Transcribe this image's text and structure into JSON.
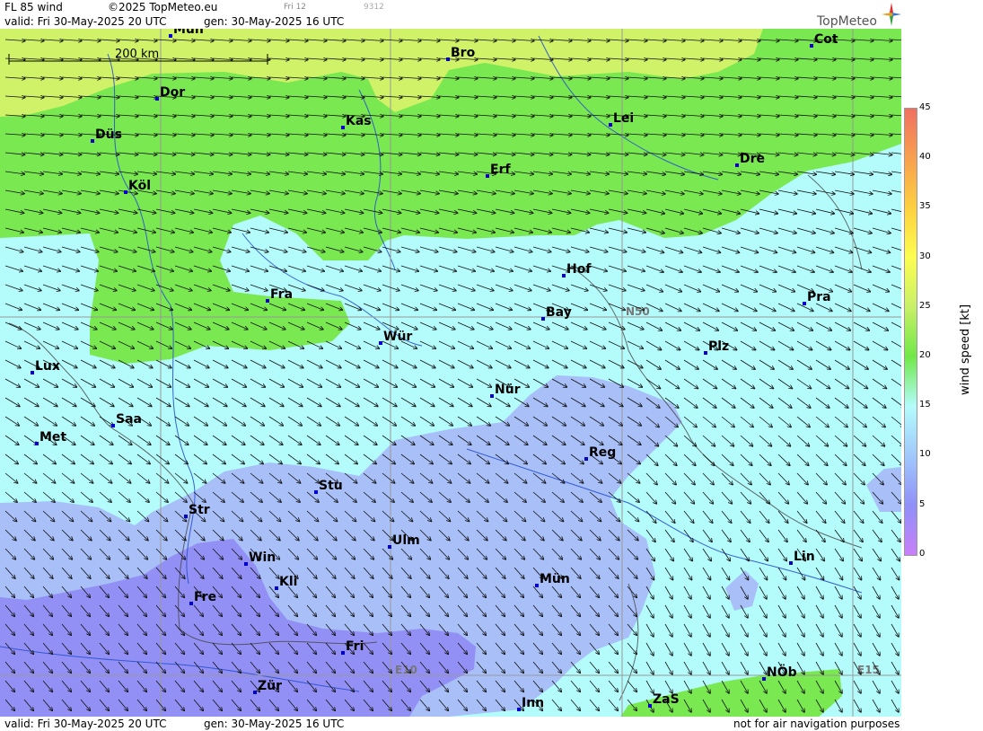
{
  "header": {
    "title": "FL 85 wind",
    "copyright": "©2025 TopMeteo.eu",
    "slot_label": "Fri 12",
    "code": "9312",
    "valid": "valid:  Fri  30-May-2025  20 UTC",
    "gen": "gen:  30-May-2025 16 UTC",
    "logo": "TopMeteo"
  },
  "footer": {
    "valid": "valid:  Fri  30-May-2025  20 UTC",
    "gen": "gen:  30-May-2025 16 UTC",
    "disclaimer": "not for air navigation purposes"
  },
  "scale_bar": {
    "label": "200 km"
  },
  "grid_labels": {
    "n50": "N50",
    "e10": "E10",
    "e15": "E15"
  },
  "cities": [
    {
      "name": "Mün",
      "id": "top"
    },
    {
      "name": "Bro"
    },
    {
      "name": "Cot"
    },
    {
      "name": "Dor"
    },
    {
      "name": "Kas"
    },
    {
      "name": "Lei"
    },
    {
      "name": "Düs"
    },
    {
      "name": "Dre"
    },
    {
      "name": "Erf"
    },
    {
      "name": "Köl"
    },
    {
      "name": "Hof"
    },
    {
      "name": "Fra"
    },
    {
      "name": "Pra"
    },
    {
      "name": "Bay"
    },
    {
      "name": "Wür"
    },
    {
      "name": "Plz"
    },
    {
      "name": "Lux"
    },
    {
      "name": "Nür"
    },
    {
      "name": "Saa"
    },
    {
      "name": "Met"
    },
    {
      "name": "Reg"
    },
    {
      "name": "Stu"
    },
    {
      "name": "Str"
    },
    {
      "name": "Ulm"
    },
    {
      "name": "Win"
    },
    {
      "name": "Lin"
    },
    {
      "name": "Kli"
    },
    {
      "name": "Mün"
    },
    {
      "name": "Fre"
    },
    {
      "name": "Fri"
    },
    {
      "name": "NÖb"
    },
    {
      "name": "Zür"
    },
    {
      "name": "ZaS"
    },
    {
      "name": "Inn"
    }
  ],
  "legend": {
    "title": "wind speed [kt]",
    "ticks": [
      "45",
      "40",
      "35",
      "30",
      "25",
      "20",
      "15",
      "10",
      "5",
      "0"
    ],
    "colors": [
      "#f07060",
      "#f8a050",
      "#fdd040",
      "#fdfd50",
      "#c8f068",
      "#70e848",
      "#b4fcfc",
      "#a0c8fc",
      "#9090f8",
      "#c880f8"
    ]
  },
  "colors": {
    "band_15_20": "#b4fcfc",
    "band_10_15": "#a8bff8",
    "band_5_10": "#9290f4",
    "band_20_25": "#7ae850",
    "band_25_30": "#cff268"
  }
}
